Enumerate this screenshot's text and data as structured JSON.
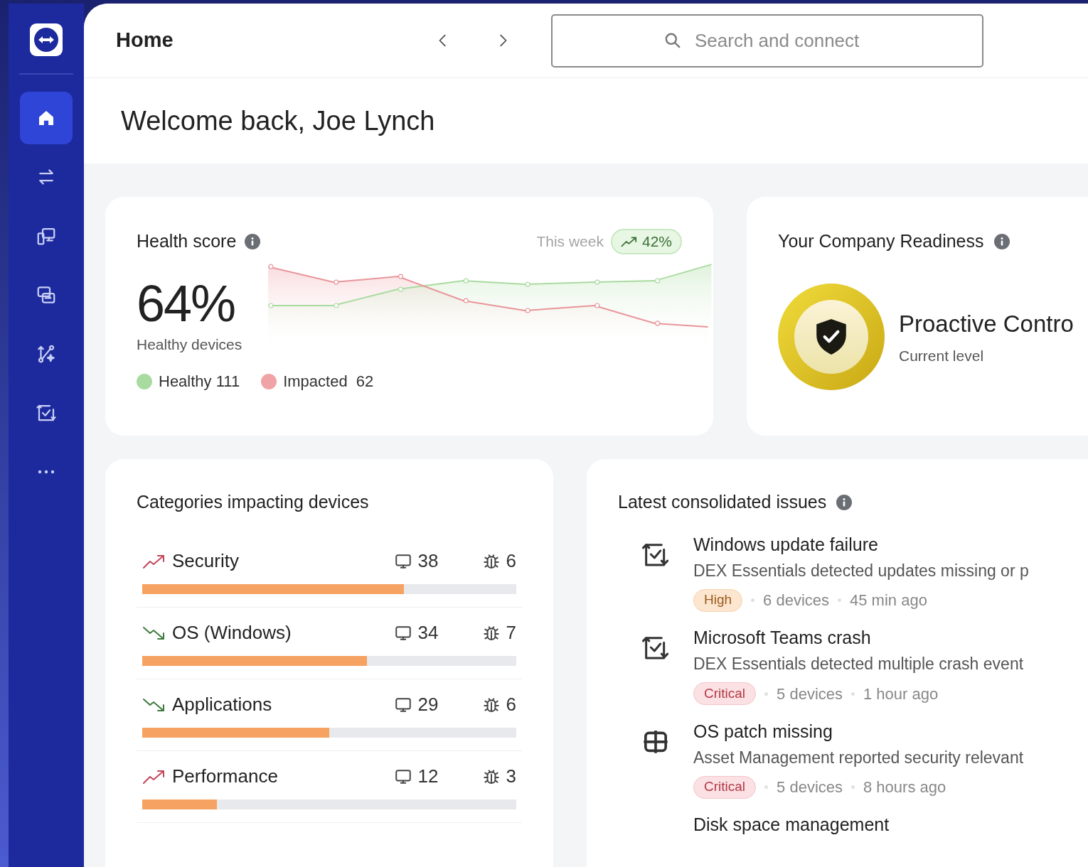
{
  "sidebar": {
    "items": [
      {
        "selected": true
      },
      {
        "selected": false
      },
      {
        "selected": false
      },
      {
        "selected": false
      },
      {
        "selected": false
      },
      {
        "selected": false
      },
      {
        "selected": false
      }
    ]
  },
  "header": {
    "title": "Home",
    "search": {
      "placeholder": "Search and connect"
    }
  },
  "welcome": "Welcome back, Joe Lynch",
  "health_score": {
    "title": "Health score",
    "period": "This week",
    "change": "42%",
    "value": "64%",
    "caption": "Healthy devices",
    "legend": [
      {
        "label": "Healthy 111",
        "color": "#a9dba0"
      },
      {
        "label": "Impacted  62",
        "color": "#f0a3a6"
      }
    ]
  },
  "readiness": {
    "title": "Your Company Readiness",
    "level": "Proactive Contro",
    "caption": "Current level"
  },
  "categories": {
    "title": "Categories impacting devices",
    "rows": [
      {
        "name": "Security",
        "kind": "up",
        "devices": "38",
        "issues": "6",
        "level": 0.7
      },
      {
        "name": "OS (Windows)",
        "kind": "down",
        "devices": "34",
        "issues": "7",
        "level": 0.6
      },
      {
        "name": "Applications",
        "kind": "down",
        "devices": "29",
        "issues": "6",
        "level": 0.5
      },
      {
        "name": "Performance",
        "kind": "up",
        "devices": "12",
        "issues": "3",
        "level": 0.2
      }
    ]
  },
  "issues": {
    "title": "Latest consolidated issues",
    "items": [
      {
        "title": "Windows update failure",
        "description": "DEX Essentials detected updates missing or p",
        "severity": {
          "kind": "high",
          "label": "High"
        },
        "devices": "6 devices",
        "time": "45 min ago"
      },
      {
        "title": "Microsoft Teams crash",
        "description": "DEX Essentials detected multiple crash event",
        "severity": {
          "kind": "critical",
          "label": "Critical"
        },
        "devices": "5 devices",
        "time": "1 hour ago"
      },
      {
        "title": "OS patch missing",
        "description": "Asset Management reported security relevant",
        "severity": {
          "kind": "critical",
          "label": "Critical"
        },
        "devices": "5 devices",
        "time": "8 hours ago"
      },
      {
        "title": "Disk space management"
      }
    ]
  }
}
